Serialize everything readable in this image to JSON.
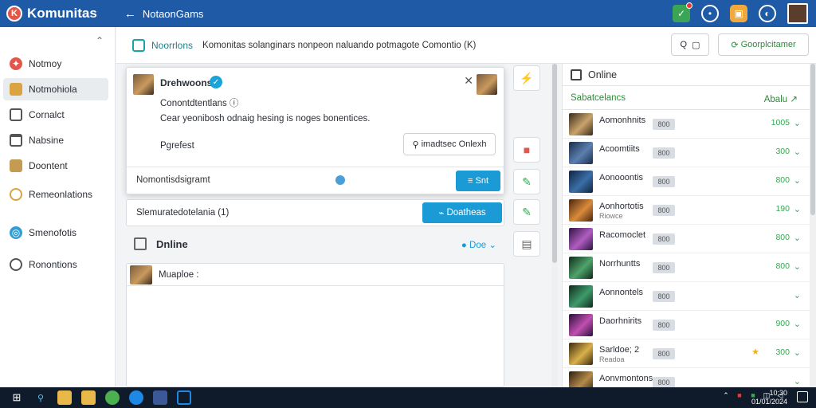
{
  "app": {
    "title": "Komunitas",
    "window_title": "NotaonGams",
    "logo_letter": "K"
  },
  "sidebar": {
    "items": [
      {
        "label": "Notmoy",
        "icon": "community-icon"
      },
      {
        "label": "Notmohiola",
        "icon": "folder-icon"
      },
      {
        "label": "Cornalct",
        "icon": "list-icon"
      },
      {
        "label": "Nabsine",
        "icon": "terminal-icon"
      },
      {
        "label": "Doontent",
        "icon": "folder-icon"
      },
      {
        "label": "Remeonlations",
        "icon": "chat-icon"
      },
      {
        "label": "Smenofotis",
        "icon": "globe-icon"
      },
      {
        "label": "Ronontions",
        "icon": "user-icon"
      }
    ]
  },
  "toolbar": {
    "title": "Noorrlons",
    "description": "Komonitas solanginars nonpeon naluando potmagote Comontio (K)",
    "search_label": "Q",
    "action_label": "Goorplcitamer"
  },
  "popup": {
    "name": "Drehwoons",
    "line1": "Conontdtentlans",
    "message": "Cear yeonibosh odnaig hesing is noges bonentices.",
    "preset_label": "Pgrefest",
    "select_label": "imadtsec Onlexh",
    "footer_text": "Nomontisdsigramt",
    "send_label": "Snt"
  },
  "bar2": {
    "text": "Slemuratedotelania (1)",
    "button_label": "Doatheas"
  },
  "online_section": {
    "title": "Dnline",
    "dropdown_label": "Doe",
    "rows": [
      {
        "label": "Muaploe :"
      }
    ]
  },
  "right_panel": {
    "title": "Online",
    "sub_left": "Sabatcelancs",
    "sub_right": "Abalu",
    "players": [
      {
        "name": "Aomonhnits",
        "sub": "",
        "badge": "800",
        "value": "1005",
        "star": false
      },
      {
        "name": "Acoomtiits",
        "sub": "",
        "badge": "800",
        "value": "300",
        "star": false
      },
      {
        "name": "Aonooontis",
        "sub": "",
        "badge": "800",
        "value": "800",
        "star": false
      },
      {
        "name": "Aonhortotis",
        "sub": "Riowce",
        "badge": "800",
        "value": "190",
        "star": false
      },
      {
        "name": "Racomoclet",
        "sub": "",
        "badge": "800",
        "value": "800",
        "star": false
      },
      {
        "name": "Norrhuntts",
        "sub": "",
        "badge": "800",
        "value": "800",
        "star": false
      },
      {
        "name": "Aonnontels",
        "sub": "",
        "badge": "800",
        "value": "",
        "star": false
      },
      {
        "name": "Daorhnirits",
        "sub": "",
        "badge": "800",
        "value": "900",
        "star": false
      },
      {
        "name": "Sarldoe; 2",
        "sub": "Readoa",
        "badge": "800",
        "value": "300",
        "star": true
      },
      {
        "name": "Aonvmontons",
        "sub": "",
        "badge": "800",
        "value": "",
        "star": false
      }
    ]
  },
  "taskbar": {
    "time": "10:30",
    "date": "01/01/2024"
  },
  "colors": {
    "topbar": "#1f5aa6",
    "accent": "#1a9bd6",
    "green": "#3aa655"
  }
}
